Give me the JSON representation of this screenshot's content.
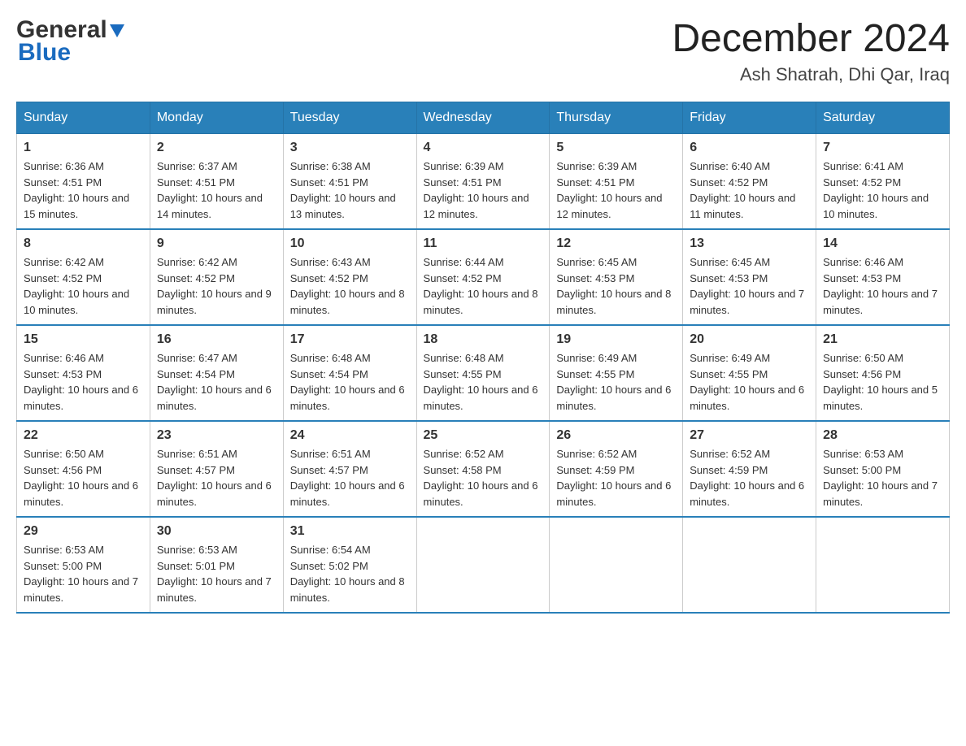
{
  "logo": {
    "general": "General",
    "blue": "Blue"
  },
  "title": "December 2024",
  "location": "Ash Shatrah, Dhi Qar, Iraq",
  "days_header": [
    "Sunday",
    "Monday",
    "Tuesday",
    "Wednesday",
    "Thursday",
    "Friday",
    "Saturday"
  ],
  "weeks": [
    [
      {
        "day": "1",
        "sunrise": "6:36 AM",
        "sunset": "4:51 PM",
        "daylight": "10 hours and 15 minutes."
      },
      {
        "day": "2",
        "sunrise": "6:37 AM",
        "sunset": "4:51 PM",
        "daylight": "10 hours and 14 minutes."
      },
      {
        "day": "3",
        "sunrise": "6:38 AM",
        "sunset": "4:51 PM",
        "daylight": "10 hours and 13 minutes."
      },
      {
        "day": "4",
        "sunrise": "6:39 AM",
        "sunset": "4:51 PM",
        "daylight": "10 hours and 12 minutes."
      },
      {
        "day": "5",
        "sunrise": "6:39 AM",
        "sunset": "4:51 PM",
        "daylight": "10 hours and 12 minutes."
      },
      {
        "day": "6",
        "sunrise": "6:40 AM",
        "sunset": "4:52 PM",
        "daylight": "10 hours and 11 minutes."
      },
      {
        "day": "7",
        "sunrise": "6:41 AM",
        "sunset": "4:52 PM",
        "daylight": "10 hours and 10 minutes."
      }
    ],
    [
      {
        "day": "8",
        "sunrise": "6:42 AM",
        "sunset": "4:52 PM",
        "daylight": "10 hours and 10 minutes."
      },
      {
        "day": "9",
        "sunrise": "6:42 AM",
        "sunset": "4:52 PM",
        "daylight": "10 hours and 9 minutes."
      },
      {
        "day": "10",
        "sunrise": "6:43 AM",
        "sunset": "4:52 PM",
        "daylight": "10 hours and 8 minutes."
      },
      {
        "day": "11",
        "sunrise": "6:44 AM",
        "sunset": "4:52 PM",
        "daylight": "10 hours and 8 minutes."
      },
      {
        "day": "12",
        "sunrise": "6:45 AM",
        "sunset": "4:53 PM",
        "daylight": "10 hours and 8 minutes."
      },
      {
        "day": "13",
        "sunrise": "6:45 AM",
        "sunset": "4:53 PM",
        "daylight": "10 hours and 7 minutes."
      },
      {
        "day": "14",
        "sunrise": "6:46 AM",
        "sunset": "4:53 PM",
        "daylight": "10 hours and 7 minutes."
      }
    ],
    [
      {
        "day": "15",
        "sunrise": "6:46 AM",
        "sunset": "4:53 PM",
        "daylight": "10 hours and 6 minutes."
      },
      {
        "day": "16",
        "sunrise": "6:47 AM",
        "sunset": "4:54 PM",
        "daylight": "10 hours and 6 minutes."
      },
      {
        "day": "17",
        "sunrise": "6:48 AM",
        "sunset": "4:54 PM",
        "daylight": "10 hours and 6 minutes."
      },
      {
        "day": "18",
        "sunrise": "6:48 AM",
        "sunset": "4:55 PM",
        "daylight": "10 hours and 6 minutes."
      },
      {
        "day": "19",
        "sunrise": "6:49 AM",
        "sunset": "4:55 PM",
        "daylight": "10 hours and 6 minutes."
      },
      {
        "day": "20",
        "sunrise": "6:49 AM",
        "sunset": "4:55 PM",
        "daylight": "10 hours and 6 minutes."
      },
      {
        "day": "21",
        "sunrise": "6:50 AM",
        "sunset": "4:56 PM",
        "daylight": "10 hours and 5 minutes."
      }
    ],
    [
      {
        "day": "22",
        "sunrise": "6:50 AM",
        "sunset": "4:56 PM",
        "daylight": "10 hours and 6 minutes."
      },
      {
        "day": "23",
        "sunrise": "6:51 AM",
        "sunset": "4:57 PM",
        "daylight": "10 hours and 6 minutes."
      },
      {
        "day": "24",
        "sunrise": "6:51 AM",
        "sunset": "4:57 PM",
        "daylight": "10 hours and 6 minutes."
      },
      {
        "day": "25",
        "sunrise": "6:52 AM",
        "sunset": "4:58 PM",
        "daylight": "10 hours and 6 minutes."
      },
      {
        "day": "26",
        "sunrise": "6:52 AM",
        "sunset": "4:59 PM",
        "daylight": "10 hours and 6 minutes."
      },
      {
        "day": "27",
        "sunrise": "6:52 AM",
        "sunset": "4:59 PM",
        "daylight": "10 hours and 6 minutes."
      },
      {
        "day": "28",
        "sunrise": "6:53 AM",
        "sunset": "5:00 PM",
        "daylight": "10 hours and 7 minutes."
      }
    ],
    [
      {
        "day": "29",
        "sunrise": "6:53 AM",
        "sunset": "5:00 PM",
        "daylight": "10 hours and 7 minutes."
      },
      {
        "day": "30",
        "sunrise": "6:53 AM",
        "sunset": "5:01 PM",
        "daylight": "10 hours and 7 minutes."
      },
      {
        "day": "31",
        "sunrise": "6:54 AM",
        "sunset": "5:02 PM",
        "daylight": "10 hours and 8 minutes."
      },
      null,
      null,
      null,
      null
    ]
  ],
  "labels": {
    "sunrise": "Sunrise:",
    "sunset": "Sunset:",
    "daylight": "Daylight:"
  }
}
